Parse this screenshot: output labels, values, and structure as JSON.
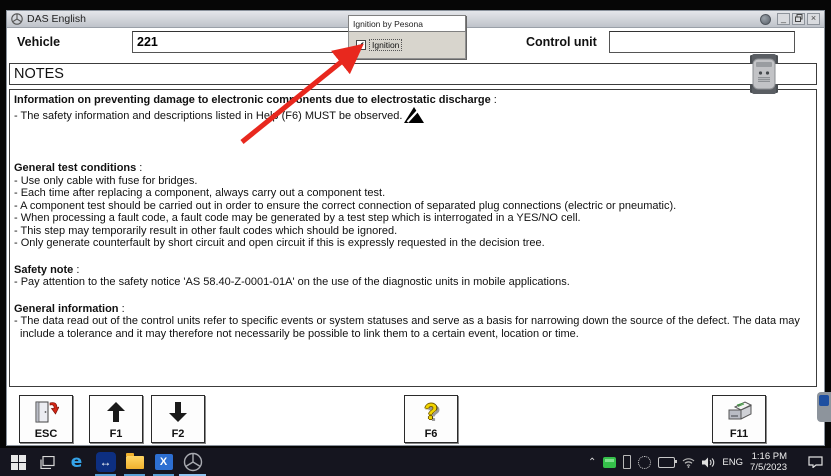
{
  "window": {
    "title": "DAS English",
    "controls": {
      "minimize": "_",
      "close": "×"
    }
  },
  "header": {
    "vehicle_label": "Vehicle",
    "vehicle_value": "221",
    "control_unit_label": "Control unit",
    "control_unit_value": ""
  },
  "popup": {
    "title": "Ignition by Pesona",
    "checkbox_label": "Ignition",
    "check_glyph": "✔"
  },
  "notes": {
    "title": "NOTES",
    "sections": [
      {
        "heading": "Information on preventing damage to electronic components due to electrostatic discharge",
        "colon": " :",
        "lines": [
          "- The safety information and descriptions listed in Help (F6) MUST be observed."
        ]
      },
      {
        "heading": "General test conditions",
        "colon": " :",
        "lines": [
          "- Use only cable with fuse for bridges.",
          "- Each time after replacing a component, always carry out a component test.",
          "- A component test should be carried out in order to ensure the correct connection of separated plug connections (electric or pneumatic).",
          "- When processing a fault code, a fault code may be generated by a test step which is interrogated in a YES/NO cell.",
          "- This step may temporarily result in other fault codes which should be ignored.",
          "- Only generate counterfault by short circuit and open circuit if this is expressly requested in the decision tree."
        ]
      },
      {
        "heading": "Safety note",
        "colon": " :",
        "lines": [
          "- Pay attention to the safety notice 'AS 58.40-Z-0001-01A' on the use of the diagnostic units in mobile applications."
        ]
      },
      {
        "heading": "General information",
        "colon": " :",
        "lines": [
          "- The data read out of the control units refer to specific events or system statuses and serve as a basis for narrowing down the source of the defect. The data may include a tolerance and it may therefore not necessarily be possible to link them to a certain event, location or time."
        ]
      }
    ]
  },
  "toolbar": {
    "buttons": [
      {
        "key": "ESC",
        "icon": "exit-door-icon"
      },
      {
        "key": "F1",
        "icon": "arrow-up-icon"
      },
      {
        "key": "F2",
        "icon": "arrow-down-icon"
      },
      {
        "key": "F6",
        "icon": "help-question-icon"
      },
      {
        "key": "F11",
        "icon": "printer-icon"
      }
    ]
  },
  "taskbar": {
    "language": "ENG",
    "time": "1:16 PM",
    "date": "7/5/2023"
  },
  "colors": {
    "accent_red": "#e8281e",
    "taskbar_underline": "#5a9fd4",
    "help_yellow": "#f2d400"
  }
}
